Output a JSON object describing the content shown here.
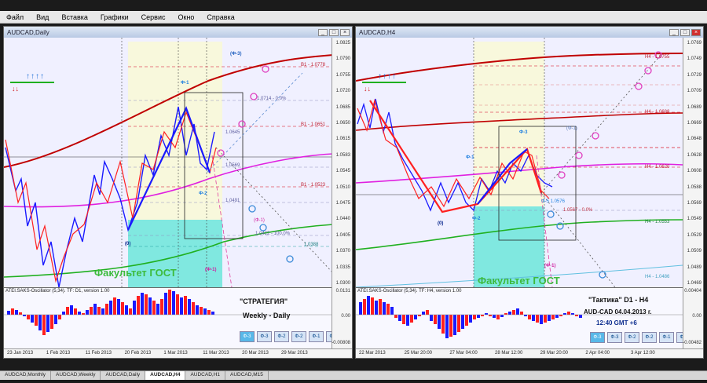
{
  "menu": [
    "Файл",
    "Вид",
    "Вставка",
    "Графики",
    "Сервис",
    "Окно",
    "Справка"
  ],
  "left": {
    "title": "AUDCAD,Daily",
    "prices": [
      "1.0825",
      "1.0790",
      "1.0755",
      "1.0720",
      "1.0685",
      "1.0650",
      "1.0615",
      "1.0583",
      "1.0545",
      "1.0510",
      "1.0475",
      "1.0440",
      "1.0405",
      "1.0370",
      "1.0335",
      "1.0300"
    ],
    "labels": {
      "phi3": "(Ф-3)",
      "phi1": "Ф-1",
      "phi2": "Ф-2",
      "zero": "(0)",
      "m1": "(Ф-1)",
      "m1b": "(Ф-1)",
      "b1a": "B1 - 1.0778",
      "b1b": "B1 - 1.0651",
      "b1c": "B1 - 1.0523",
      "f0": "1.0714 - 0.0%",
      "f1": "1.0569",
      "f2": "1.0491",
      "f3": "1.0422 - 100.0%",
      "f4": "1.0388",
      "f5": "1.0645"
    },
    "osc": {
      "label": "ATEI.SAKS-Oscillator (5,34). TF: D1, version 1.00",
      "top": "0.0131",
      "mid": "0.00",
      "bot": "-0.00808"
    },
    "strategy": "\"СТРАТЕГИЯ\"",
    "sub": "Weekly - Daily",
    "watermark": "Факультет ГОСТ",
    "phi_buttons": [
      "Ф-3",
      "Ф-3",
      "Ф-2",
      "Ф-2",
      "Ф-1",
      "Ф-1"
    ],
    "dates": [
      "23 Jan 2013",
      "1 Feb 2013",
      "11 Feb 2013",
      "20 Feb 2013",
      "1 Mar 2013",
      "11 Mar 2013",
      "20 Mar 2013",
      "29 Mar 2013"
    ]
  },
  "right": {
    "title": "AUDCAD,H4",
    "prices": [
      "1.0769",
      "1.0749",
      "1.0729",
      "1.0709",
      "1.0689",
      "1.0669",
      "1.0648",
      "1.0628",
      "1.0608",
      "1.0588",
      "1.0569",
      "1.0549",
      "1.0529",
      "1.0509",
      "1.0489",
      "1.0469"
    ],
    "labels": {
      "phi3": "Ф-3",
      "phi1": "Ф-1",
      "phi2": "Ф-2",
      "zero": "(0)",
      "m1": "(Ф-1)",
      "m1b": "(Ф-1)",
      "h4a": "H4 - 1.0755",
      "h4b": "H4 - 1.0688",
      "h4c": "H4 - 1.0620",
      "h4d": "H4 - 1.0553",
      "h4e": "H4 - 1.0486",
      "f0": "1.0567 - 0.0%",
      "f1": "Ф-5 1.0576"
    },
    "osc": {
      "label": "ATEI.SAKS-Oscillator (5,34). TF: H4, version 1.00",
      "top": "0.00404",
      "mid": "0.00",
      "bot": "-0.00482"
    },
    "strategy": "\"Тактика\"  D1 - H4",
    "pair": "AUD-CAD      04.04.2013  г.",
    "time": "12:40   GMT +6",
    "watermark": "Факультет ГОСТ",
    "phi_buttons": [
      "Ф-3",
      "Ф-3",
      "Ф-2",
      "Ф-2",
      "Ф-1",
      "Ф-1"
    ],
    "dates": [
      "22 Mar 2013",
      "25 Mar 20:00",
      "27 Mar 04:00",
      "28 Mar 12:00",
      "29 Mar 20:00",
      "2 Apr 04:00",
      "3 Apr 12:00"
    ]
  },
  "tabs": [
    "AUDCAD,Monthly",
    "AUDCAD,Weekly",
    "AUDCAD,Daily",
    "AUDCAD,H4",
    "AUDCAD,H1",
    "AUDCAD,M15"
  ],
  "active_tab": "AUDCAD,H4",
  "colors": {
    "bull": "#1a1aff",
    "bear": "#ff2020",
    "ma_red": "#c00000",
    "ma_magenta": "#e020e0",
    "ma_green": "#20b020"
  }
}
